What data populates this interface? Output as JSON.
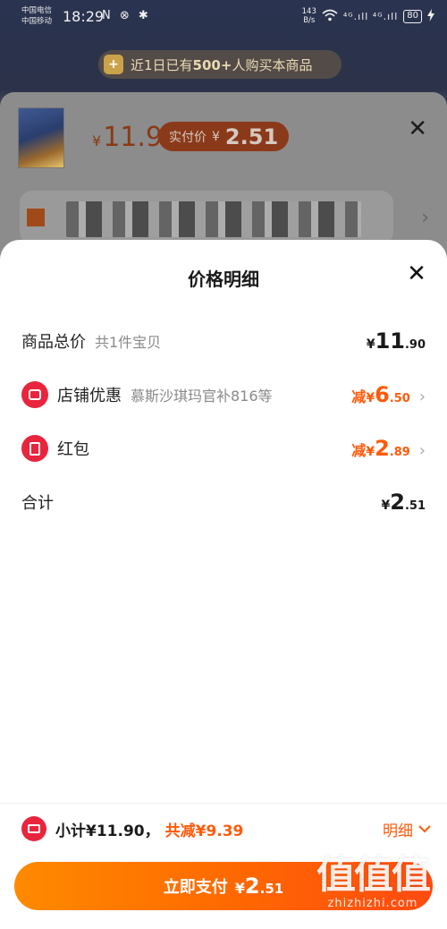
{
  "status_bar": {
    "carrier_1": "中国电信",
    "carrier_2": "中国移动",
    "time": "18:29",
    "left_icons": "N ⊗ ✱",
    "net_speed_value": "143",
    "net_speed_unit": "B/s",
    "signal": "⁴ᴳ.ıll ⁴ᴳ.ıll",
    "battery": "80"
  },
  "promo_banner": {
    "icon_glyph": "+",
    "text_prefix": "近1日已有",
    "count": "500+",
    "text_suffix": "人购买本商品"
  },
  "sku_sheet": {
    "currency": "¥",
    "price": "11.9",
    "real_price_label": "实付价",
    "real_price_currency": "¥",
    "real_price": "2.51",
    "close_glyph": "✕"
  },
  "price_detail": {
    "title": "价格明细",
    "close_glyph": "✕",
    "total": {
      "label": "商品总价",
      "sub": "共1件宝贝",
      "currency": "¥",
      "int": "11",
      "dec": ".90"
    },
    "shop_discount": {
      "label": "店铺优惠",
      "sub": "慕斯沙琪玛官补816等",
      "prefix": "减",
      "currency": "¥",
      "int": "6",
      "dec": ".50"
    },
    "red_packet": {
      "label": "红包",
      "prefix": "减",
      "currency": "¥",
      "int": "2",
      "dec": ".89"
    },
    "sum": {
      "label": "合计",
      "currency": "¥",
      "int": "2",
      "dec": ".51"
    }
  },
  "bottom_bar": {
    "subtotal": "小计¥11.90，",
    "total_off": "共减¥9.39",
    "detail_label": "明细",
    "pay_label": "立即支付",
    "pay_currency": "¥",
    "pay_int": "2",
    "pay_dec": ".51"
  },
  "watermark": {
    "big": "值值值",
    "small": "zhizhizhi.com"
  },
  "colors": {
    "accent": "#ff5a0a",
    "icon_red": "#e8253d",
    "overlay_bg": "#3a3f52"
  }
}
